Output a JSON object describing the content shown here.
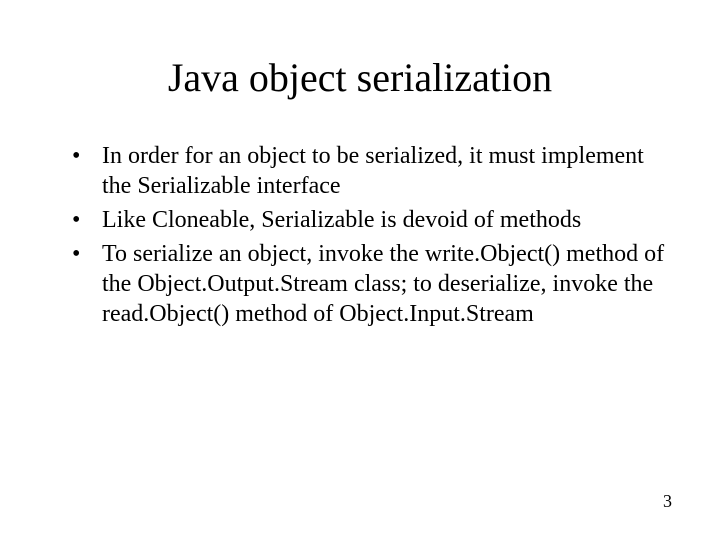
{
  "title": "Java object serialization",
  "bullets": [
    "In order for an object to be serialized, it must implement the Serializable interface",
    "Like Cloneable, Serializable is devoid of methods",
    "To serialize an object, invoke the write.Object() method of the Object.Output.Stream class; to deserialize, invoke the read.Object() method of Object.Input.Stream"
  ],
  "page_number": "3"
}
